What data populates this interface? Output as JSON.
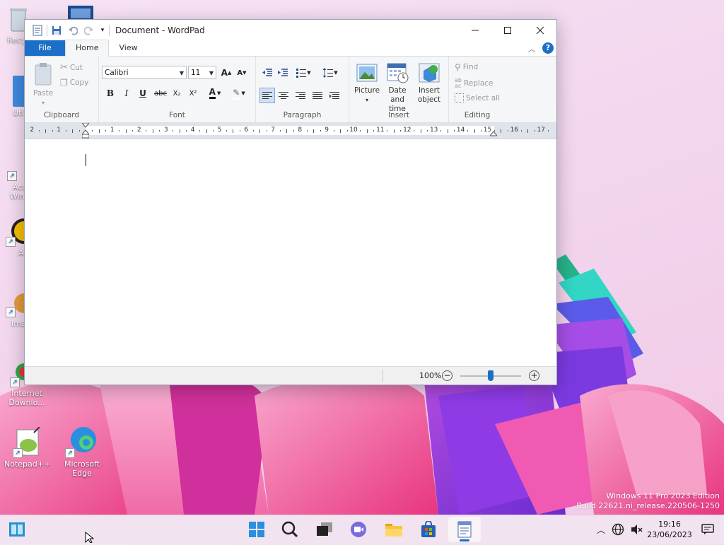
{
  "window": {
    "title": "Document - WordPad"
  },
  "tabs": {
    "file": "File",
    "home": "Home",
    "view": "View",
    "help": "?"
  },
  "ribbon": {
    "clipboard": {
      "label": "Clipboard",
      "paste": "Paste",
      "cut": "Cut",
      "copy": "Copy"
    },
    "font": {
      "label": "Font",
      "family": "Calibri",
      "size": "11",
      "bold": "B",
      "italic": "I",
      "underline": "U",
      "strike": "abc",
      "subscript": "X₂",
      "superscript": "X²",
      "color_glyph": "A"
    },
    "paragraph": {
      "label": "Paragraph"
    },
    "insert": {
      "label": "Insert",
      "picture": "Picture",
      "datetime_line1": "Date and",
      "datetime_line2": "time",
      "object_line1": "Insert",
      "object_line2": "object"
    },
    "editing": {
      "label": "Editing",
      "find": "Find",
      "replace": "Replace",
      "select_all": "Select all"
    }
  },
  "ruler": {
    "numbers": [
      "2",
      "1",
      "1",
      "2",
      "3",
      "4",
      "5",
      "6",
      "7",
      "8",
      "9",
      "10",
      "11",
      "12",
      "13",
      "14",
      "15",
      "16",
      "17"
    ]
  },
  "statusbar": {
    "zoom": "100%"
  },
  "desktop": {
    "icons": [
      {
        "label": "Recy"
      },
      {
        "label": "Uti"
      },
      {
        "label": "Act"
      },
      {
        "label": "Win"
      },
      {
        "label": "A"
      },
      {
        "label": "Ima"
      },
      {
        "label": "Internet"
      },
      {
        "label": "Downlo..."
      },
      {
        "label": "Notepad++"
      },
      {
        "label": "Microsoft"
      },
      {
        "label": "Edge"
      }
    ]
  },
  "watermark": {
    "line1": "Windows 11 Pro 2023 Edition",
    "line2": "Build 22621.ni_release.220506-1250"
  },
  "tray": {
    "time": "19:16",
    "date": "23/06/2023"
  },
  "colors": {
    "accent": "#1c6fc8",
    "wallpaper_pink": "#f06aa8"
  }
}
